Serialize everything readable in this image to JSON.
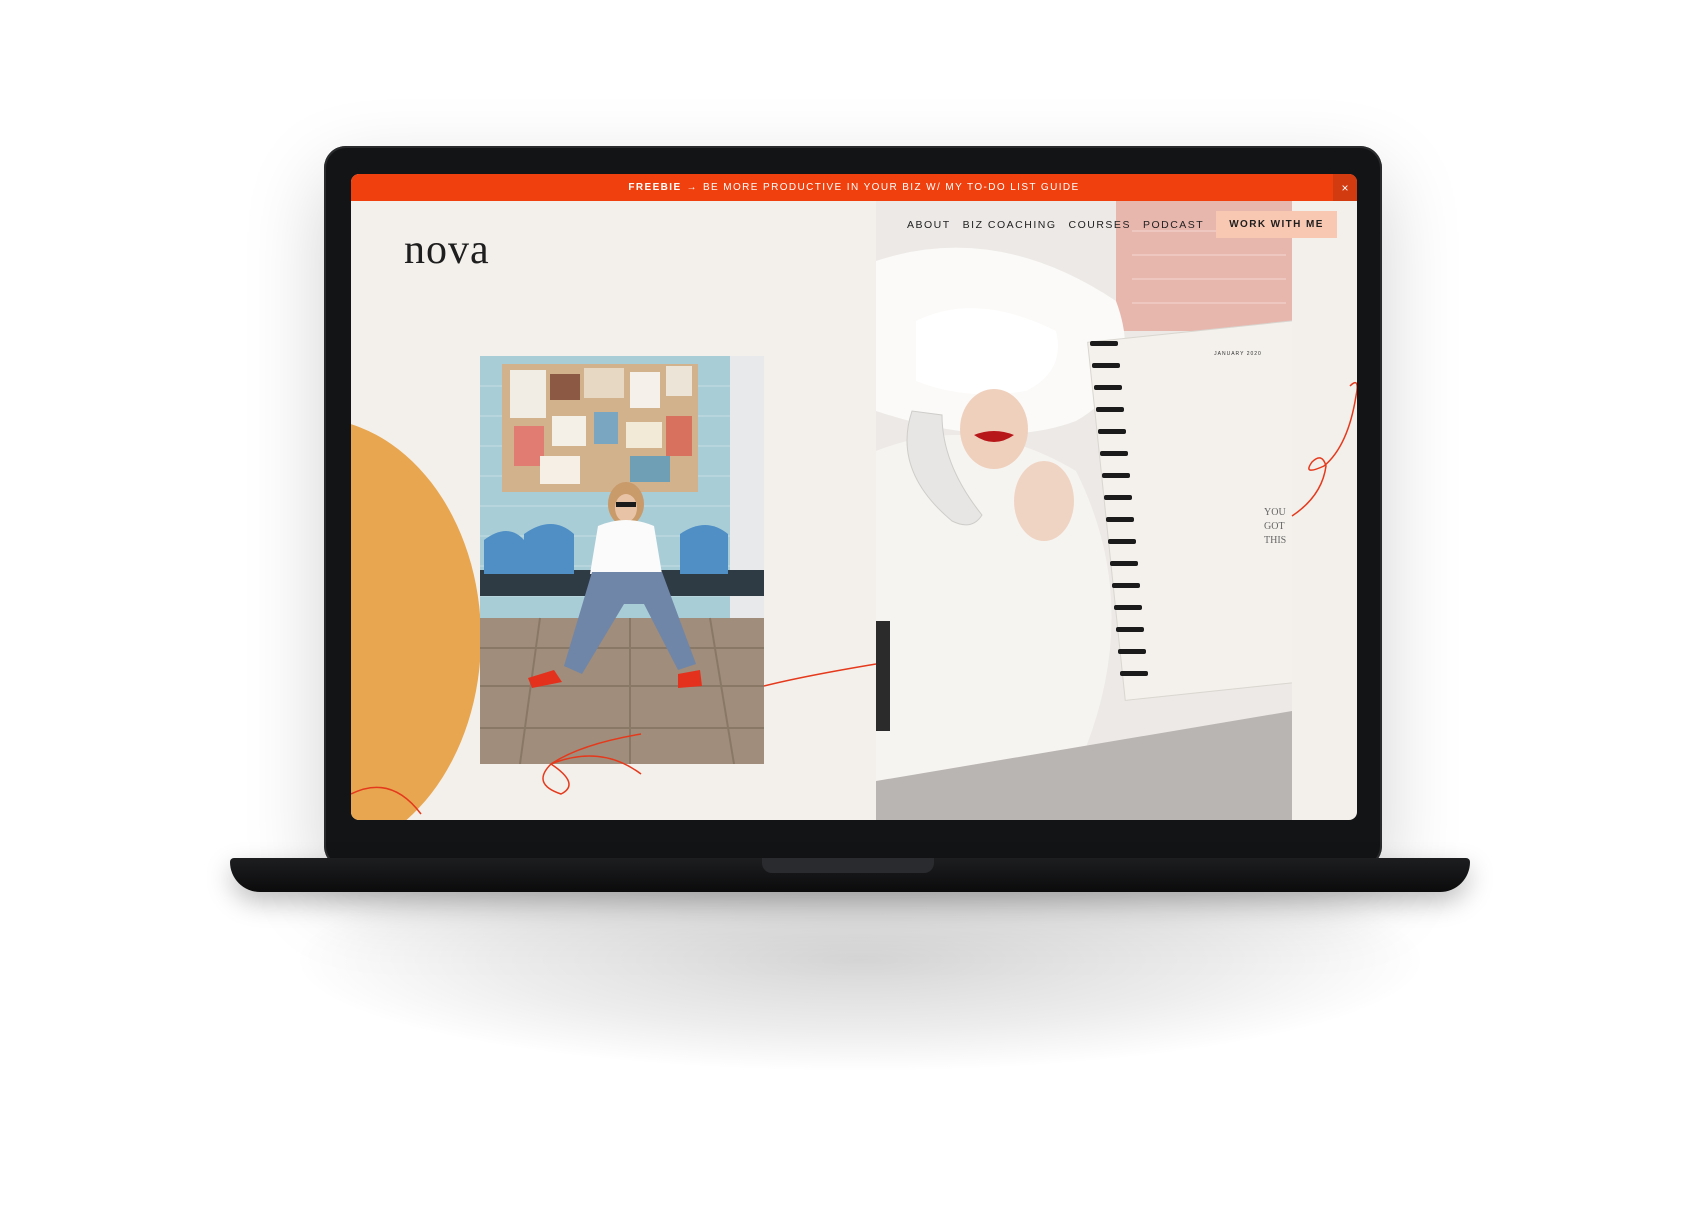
{
  "banner": {
    "label": "FREEBIE",
    "arrow": "→",
    "text": "BE MORE PRODUCTIVE IN YOUR BIZ W/ MY TO-DO LIST GUIDE",
    "close": "×"
  },
  "brand": {
    "logo": "nova"
  },
  "nav": {
    "items": [
      {
        "label": "ABOUT"
      },
      {
        "label": "BIZ COACHING"
      },
      {
        "label": "COURSES"
      },
      {
        "label": "PODCAST"
      }
    ],
    "cta": "WORK WITH ME"
  },
  "planner": {
    "month": "JANUARY 2020",
    "quote": [
      "YOU",
      "GOT",
      "THIS"
    ]
  },
  "colors": {
    "banner": "#f0400e",
    "accent_orange": "#e8a650",
    "cta_bg": "#f8c8b3",
    "page_bg": "#f3f0eb",
    "line_red": "#e5391c"
  }
}
